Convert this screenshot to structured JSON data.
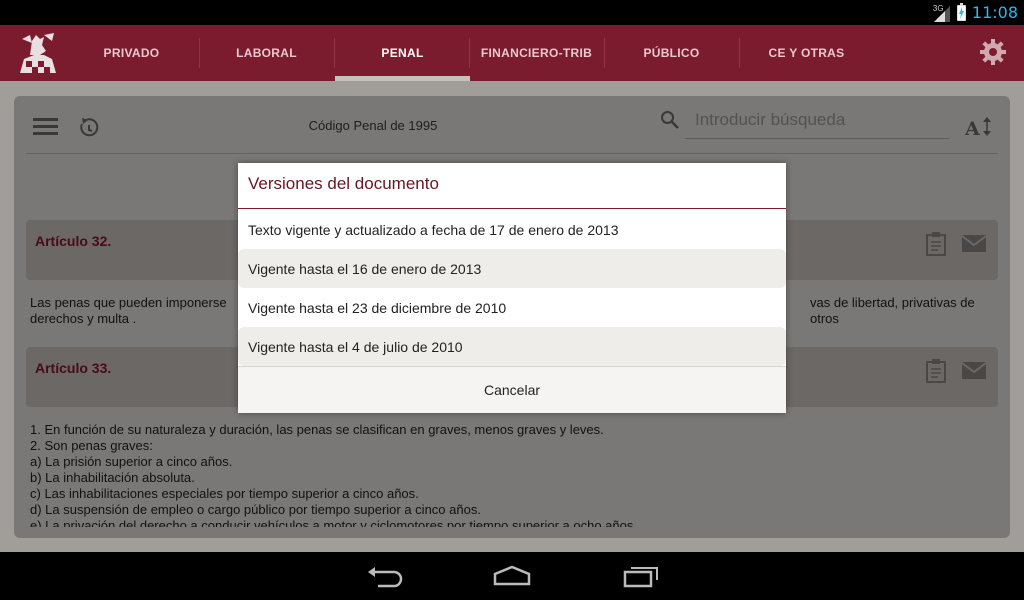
{
  "status_bar": {
    "network": "3G",
    "time": "11:08",
    "time_color": "#33b5e5"
  },
  "tabs": [
    {
      "label": "PRIVADO",
      "active": false
    },
    {
      "label": "LABORAL",
      "active": false
    },
    {
      "label": "PENAL",
      "active": true
    },
    {
      "label": "FINANCIERO-TRIB",
      "active": false
    },
    {
      "label": "PÚBLICO",
      "active": false
    },
    {
      "label": "CE Y OTRAS",
      "active": false
    }
  ],
  "toolbar": {
    "document_title": "Código Penal de 1995",
    "search_placeholder": "Introducir búsqueda",
    "menu_icon": "menu-icon",
    "history_icon": "history-icon",
    "search_icon": "search-icon",
    "font_size_icon": "font-size-icon"
  },
  "articles": [
    {
      "title": "Artículo 32.",
      "text_left": "Las penas que pueden imponerse",
      "text_right": "vas de libertad, privativas de otros",
      "text_line2": "derechos y multa ."
    },
    {
      "title": "Artículo 33.",
      "lines": [
        "1. En función de su naturaleza y duración, las penas se clasifican en graves, menos graves y leves.",
        "2. Son penas graves:",
        "a) La prisión superior a cinco años.",
        "b) La inhabilitación absoluta.",
        "c) Las inhabilitaciones especiales por tiempo superior a cinco años.",
        "d) La suspensión de empleo o cargo público por tiempo superior a cinco años.",
        "e) La privación del derecho a conducir vehículos a motor y ciclomotores por tiempo superior a ocho años."
      ]
    }
  ],
  "dialog": {
    "title": "Versiones del documento",
    "items": [
      "Texto vigente y actualizado a fecha de 17 de enero de 2013",
      "Vigente hasta el 16 de enero de 2013",
      "Vigente hasta el 23 de diciembre de 2010",
      "Vigente hasta el 4 de julio de 2010"
    ],
    "cancel_label": "Cancelar"
  },
  "colors": {
    "brand": "#7a1b2e",
    "accent": "#33b5e5"
  }
}
